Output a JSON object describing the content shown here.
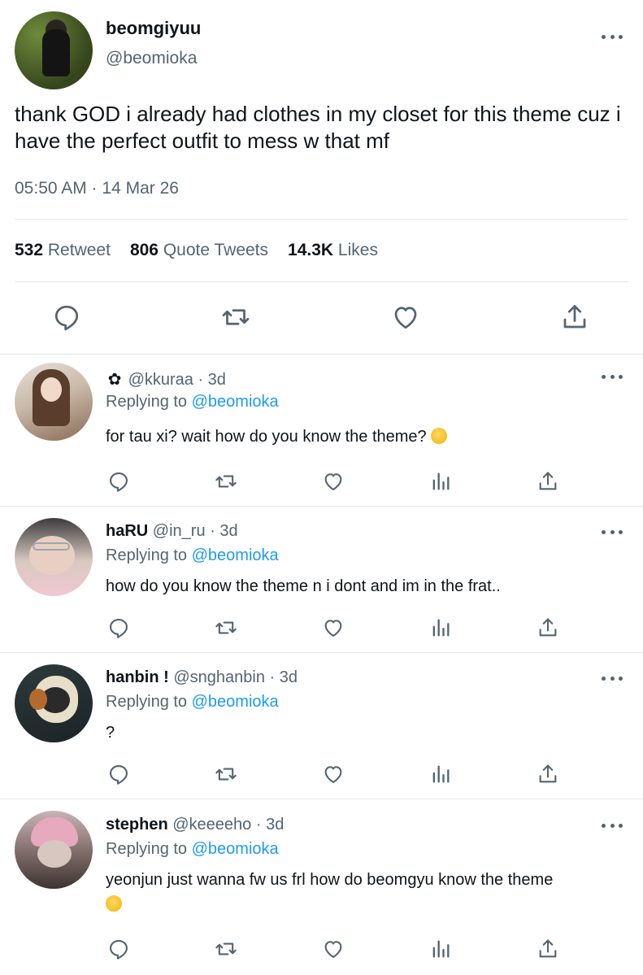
{
  "main_tweet": {
    "author_name": "beomgiyuu",
    "author_handle": "@beomioka",
    "text": "thank GOD i already had clothes in my closet for this theme cuz i have the perfect outfit to mess w that mf",
    "time": "05:50 AM · 14 Mar 26",
    "stats": [
      {
        "value": "532",
        "label": "Retweet"
      },
      {
        "value": "806",
        "label": "Quote Tweets"
      },
      {
        "value": "14.3K",
        "label": "Likes"
      }
    ]
  },
  "replies": [
    {
      "name": "",
      "prefix_emoji": "🌸",
      "handle": "@kkuraa",
      "age": "· 3d",
      "replying_label": "Replying to",
      "replying_to": "@beomioka",
      "text": "for tau xi? wait how do you know the theme?",
      "trailing_emoji": "🫠"
    },
    {
      "name": "haRU",
      "handle": "@in_ru",
      "age": "· 3d",
      "replying_label": "Replying to",
      "replying_to": "@beomioka",
      "text": "how do you know the theme n i dont and im in the frat.."
    },
    {
      "name": "hanbin !",
      "handle": "@snghanbin",
      "age": "· 3d",
      "replying_label": "Replying to",
      "replying_to": "@beomioka",
      "text": "?"
    },
    {
      "name": "stephen",
      "handle": "@keeeeho",
      "age": "· 3d",
      "replying_label": "Replying to",
      "replying_to": "@beomioka",
      "text": "yeonjun just wanna fw us frl how do beomgyu know the theme",
      "trailing_emoji": "😭"
    }
  ],
  "icons": {
    "reply": "reply-icon",
    "retweet": "retweet-icon",
    "like": "heart-icon",
    "analytics": "analytics-icon",
    "share": "share-icon",
    "more": "more-icon"
  },
  "colors": {
    "text": "#0f1419",
    "secondary": "#536471",
    "link": "#1d9bf0",
    "divider": "#e1e6ea"
  }
}
